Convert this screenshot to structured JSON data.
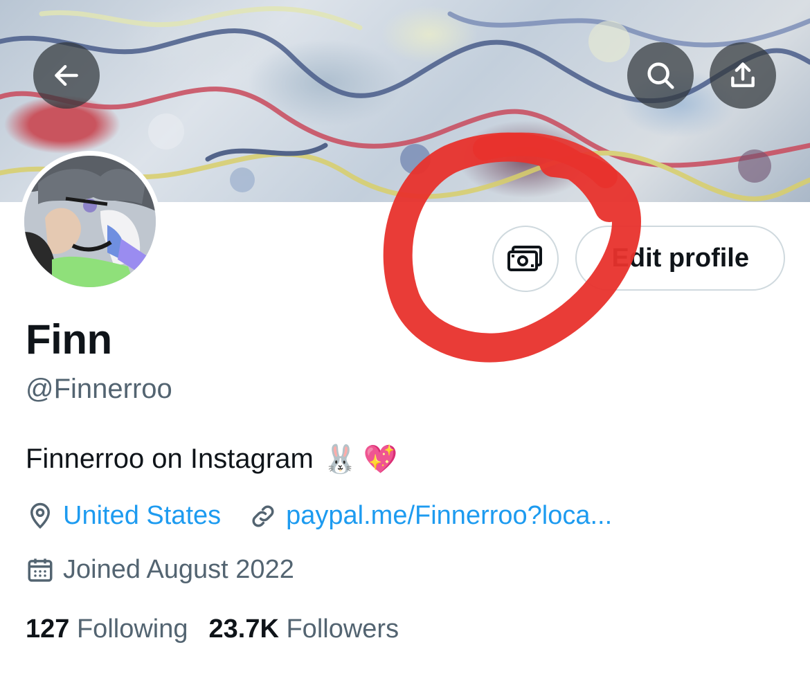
{
  "header": {
    "back_icon": "arrow-left-icon",
    "search_icon": "search-icon",
    "share_icon": "share-upload-icon"
  },
  "profile": {
    "name": "Finn",
    "handle": "@Finnerroo",
    "bio_text": "Finnerroo on Instagram",
    "bio_emoji": [
      "🐰",
      "💖"
    ],
    "location": "United States",
    "website": "paypal.me/Finnerroo?loca...",
    "joined": "Joined August 2022",
    "following_count": "127",
    "following_label": "Following",
    "followers_count": "23.7K",
    "followers_label": "Followers"
  },
  "actions": {
    "tip_icon": "money-tip-icon",
    "edit_label": "Edit profile"
  },
  "colors": {
    "link": "#1d9bf0",
    "muted": "#536471",
    "annotation": "#e8322c"
  }
}
